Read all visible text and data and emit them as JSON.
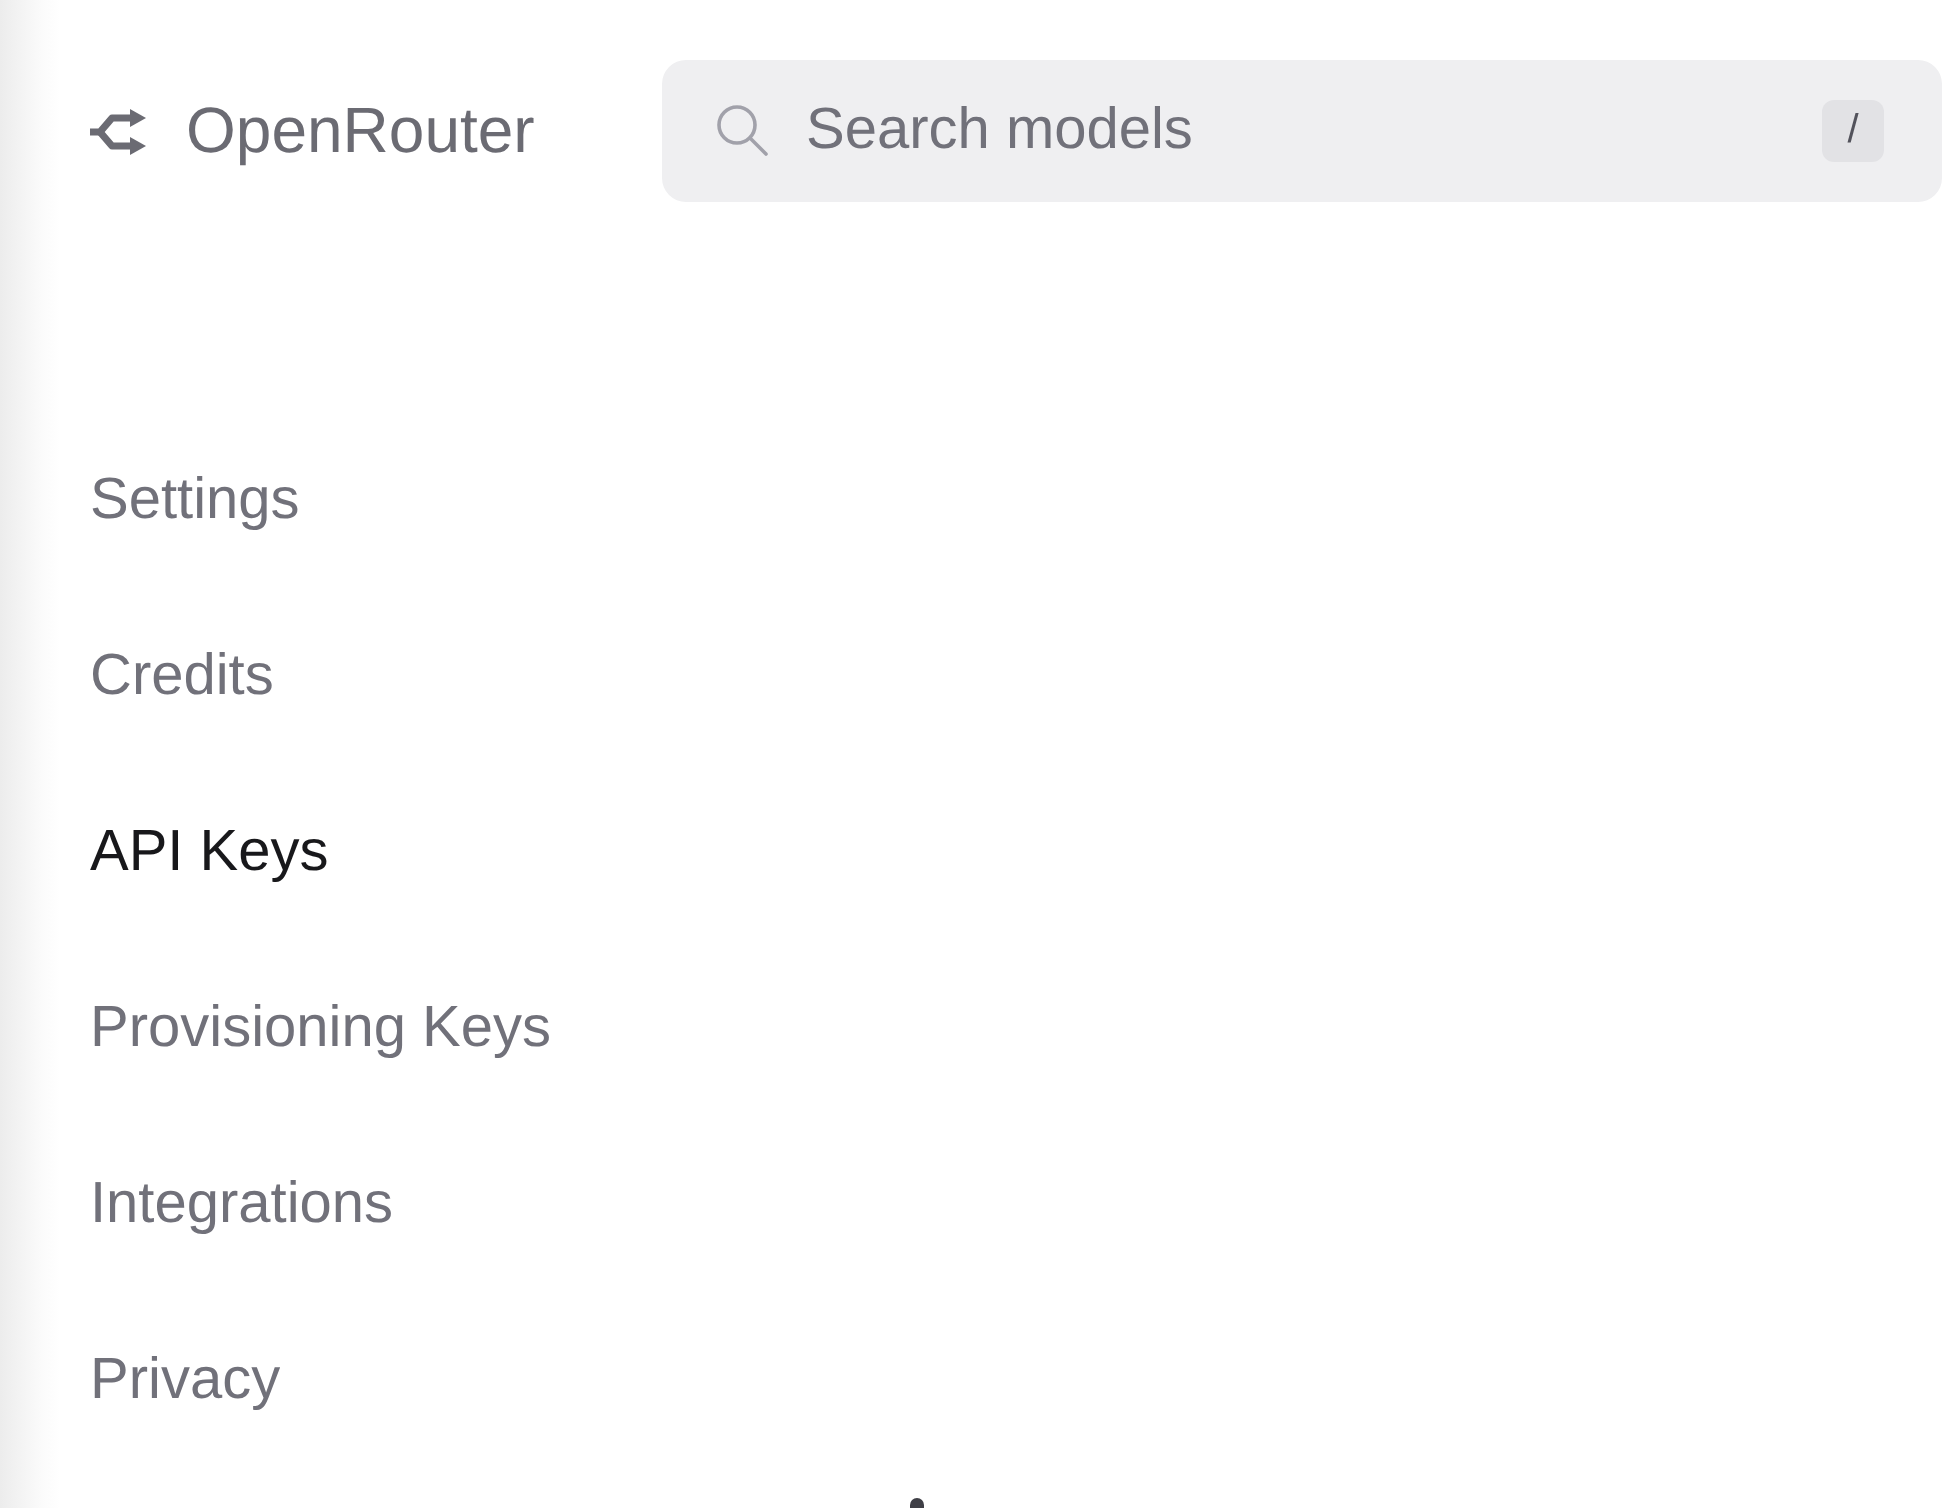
{
  "header": {
    "logo": {
      "text": "OpenRouter"
    },
    "search": {
      "placeholder": "Search models",
      "shortcut": "/"
    }
  },
  "menu": {
    "items": [
      {
        "label": "Settings",
        "selected": false
      },
      {
        "label": "Credits",
        "selected": false
      },
      {
        "label": "API Keys",
        "selected": true
      },
      {
        "label": "Provisioning Keys",
        "selected": false
      },
      {
        "label": "Integrations",
        "selected": false
      },
      {
        "label": "Privacy",
        "selected": false
      }
    ]
  }
}
